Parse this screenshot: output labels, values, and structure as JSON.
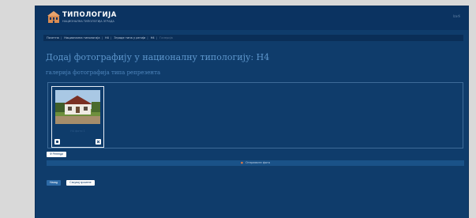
{
  "header": {
    "app_name": "ТИПОЛОГИЈА",
    "app_tagline": "НАЦИОНАЛНА ТИПОЛОГИЈА ЗГРАДА",
    "top_right_text": "Izađi"
  },
  "breadcrumb": {
    "items": [
      "Почетна",
      "Национална типологија",
      "Н4",
      "Зграде типа у регији",
      "Н4",
      "Галерија"
    ]
  },
  "page": {
    "title": "Додај фотографију у националну типологију: Н4",
    "subtitle": "галерија фотографија типа репрезента"
  },
  "gallery": {
    "items": [
      {
        "caption": "Н4 фото 1"
      }
    ]
  },
  "buttons": {
    "small_label": "Ф Ретенди",
    "upload_label": "Отпремите фото",
    "back_label": "Назад",
    "save_label": "Сачувај промене"
  },
  "colors": {
    "panel": "#0f3c6b",
    "header": "#0b3361",
    "accent": "#5d96cc",
    "upload_dot": "#e07a45"
  }
}
